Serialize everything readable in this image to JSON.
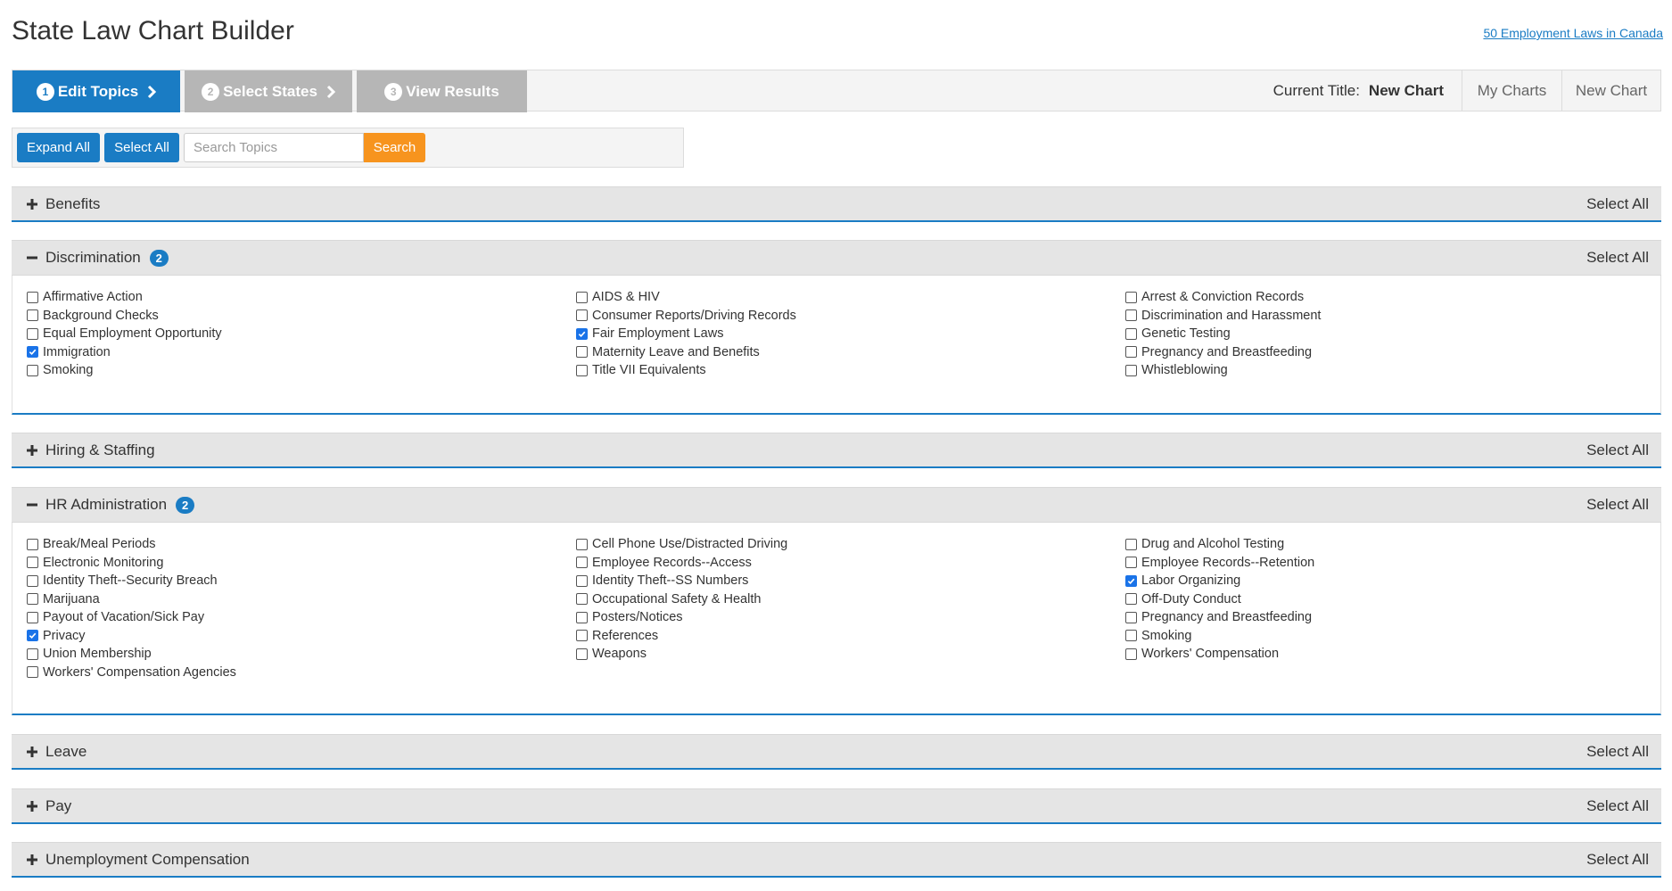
{
  "header": {
    "title": "State Law Chart Builder",
    "canada_link": "50 Employment Laws in Canada"
  },
  "wizard": {
    "steps": [
      {
        "num": "1",
        "label": "Edit Topics"
      },
      {
        "num": "2",
        "label": "Select States"
      },
      {
        "num": "3",
        "label": "View Results"
      }
    ],
    "current_title_label": "Current Title:",
    "current_title_value": "New Chart",
    "my_charts": "My Charts",
    "new_chart": "New Chart"
  },
  "toolbar": {
    "expand_all": "Expand All",
    "select_all": "Select All",
    "search_placeholder": "Search Topics",
    "search_button": "Search"
  },
  "colors": {
    "accent": "#1a7cc4",
    "search_button": "#f7941e",
    "inactive_step": "#b6b6b6",
    "header_bg": "#e5e5e5"
  },
  "icons": {
    "expand": "plus-icon",
    "collapse": "minus-icon",
    "step_next": "chevron-right-icon",
    "checked": "checkmark-icon"
  },
  "sections": {
    "benefits": {
      "title": "Benefits",
      "select_all": "Select All"
    },
    "discrimination": {
      "title": "Discrimination",
      "badge": "2",
      "select_all": "Select All",
      "columns": [
        [
          {
            "label": "Affirmative Action",
            "checked": false
          },
          {
            "label": "Background Checks",
            "checked": false
          },
          {
            "label": "Equal Employment Opportunity",
            "checked": false
          },
          {
            "label": "Immigration",
            "checked": true
          },
          {
            "label": "Smoking",
            "checked": false
          }
        ],
        [
          {
            "label": "AIDS & HIV",
            "checked": false
          },
          {
            "label": "Consumer Reports/Driving Records",
            "checked": false
          },
          {
            "label": "Fair Employment Laws",
            "checked": true
          },
          {
            "label": "Maternity Leave and Benefits",
            "checked": false
          },
          {
            "label": "Title VII Equivalents",
            "checked": false
          }
        ],
        [
          {
            "label": "Arrest & Conviction Records",
            "checked": false
          },
          {
            "label": "Discrimination and Harassment",
            "checked": false
          },
          {
            "label": "Genetic Testing",
            "checked": false
          },
          {
            "label": "Pregnancy and Breastfeeding",
            "checked": false
          },
          {
            "label": "Whistleblowing",
            "checked": false
          }
        ]
      ]
    },
    "hiring": {
      "title": "Hiring & Staffing",
      "select_all": "Select All"
    },
    "hr_admin": {
      "title": "HR Administration",
      "badge": "2",
      "select_all": "Select All",
      "columns": [
        [
          {
            "label": "Break/Meal Periods",
            "checked": false
          },
          {
            "label": "Electronic Monitoring",
            "checked": false
          },
          {
            "label": "Identity Theft--Security Breach",
            "checked": false
          },
          {
            "label": "Marijuana",
            "checked": false
          },
          {
            "label": "Payout of Vacation/Sick Pay",
            "checked": false
          },
          {
            "label": "Privacy",
            "checked": true
          },
          {
            "label": "Union Membership",
            "checked": false
          },
          {
            "label": "Workers' Compensation Agencies",
            "checked": false
          }
        ],
        [
          {
            "label": "Cell Phone Use/Distracted Driving",
            "checked": false
          },
          {
            "label": "Employee Records--Access",
            "checked": false
          },
          {
            "label": "Identity Theft--SS Numbers",
            "checked": false
          },
          {
            "label": "Occupational Safety & Health",
            "checked": false
          },
          {
            "label": "Posters/Notices",
            "checked": false
          },
          {
            "label": "References",
            "checked": false
          },
          {
            "label": "Weapons",
            "checked": false
          }
        ],
        [
          {
            "label": "Drug and Alcohol Testing",
            "checked": false
          },
          {
            "label": "Employee Records--Retention",
            "checked": false
          },
          {
            "label": "Labor Organizing",
            "checked": true
          },
          {
            "label": "Off-Duty Conduct",
            "checked": false
          },
          {
            "label": "Pregnancy and Breastfeeding",
            "checked": false
          },
          {
            "label": "Smoking",
            "checked": false
          },
          {
            "label": "Workers' Compensation",
            "checked": false
          }
        ]
      ]
    },
    "leave": {
      "title": "Leave",
      "select_all": "Select All"
    },
    "pay": {
      "title": "Pay",
      "select_all": "Select All"
    },
    "unemployment": {
      "title": "Unemployment Compensation",
      "select_all": "Select All"
    }
  }
}
